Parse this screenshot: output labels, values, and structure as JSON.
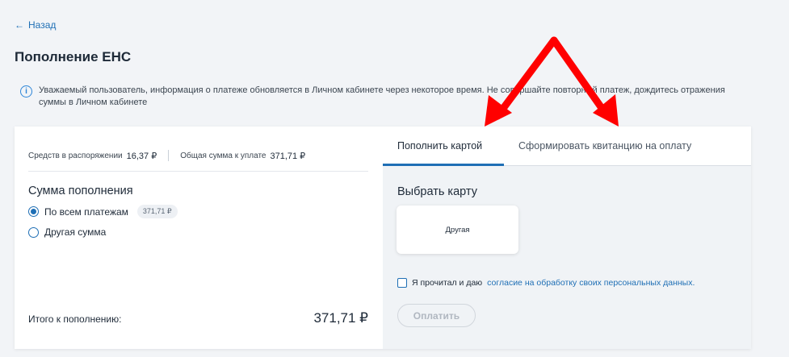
{
  "nav": {
    "back_label": "Назад",
    "back_icon": "arrow-left-icon"
  },
  "page": {
    "title": "Пополнение ЕНС"
  },
  "info": {
    "icon": "info-icon",
    "text": "Уважаемый пользователь, информация о платеже обновляется в Личном кабинете через некоторое время. Не совершайте повторный платеж, дождитесь отражения суммы в Личном кабинете"
  },
  "balance": {
    "available_label": "Средств в распоряжении",
    "available_value": "16,37 ₽",
    "due_label": "Общая сумма к уплате",
    "due_value": "371,71 ₽"
  },
  "topup": {
    "title": "Сумма пополнения",
    "options": [
      {
        "label": "По всем платежам",
        "amount": "371,71 ₽",
        "selected": true
      },
      {
        "label": "Другая сумма",
        "selected": false
      }
    ],
    "total_label": "Итого к пополнению:",
    "total_value": "371,71 ₽"
  },
  "tabs": [
    {
      "label": "Пополнить картой",
      "active": true
    },
    {
      "label": "Сформировать квитанцию на оплату",
      "active": false
    }
  ],
  "card_select": {
    "title": "Выбрать карту",
    "card_label": "Другая"
  },
  "consent": {
    "text": "Я прочитал и даю",
    "link_text": "согласие на обработку своих персональных данных."
  },
  "pay_button_label": "Оплатить",
  "colors": {
    "accent": "#1f6fb5",
    "annotation_arrow": "#ff0000"
  }
}
